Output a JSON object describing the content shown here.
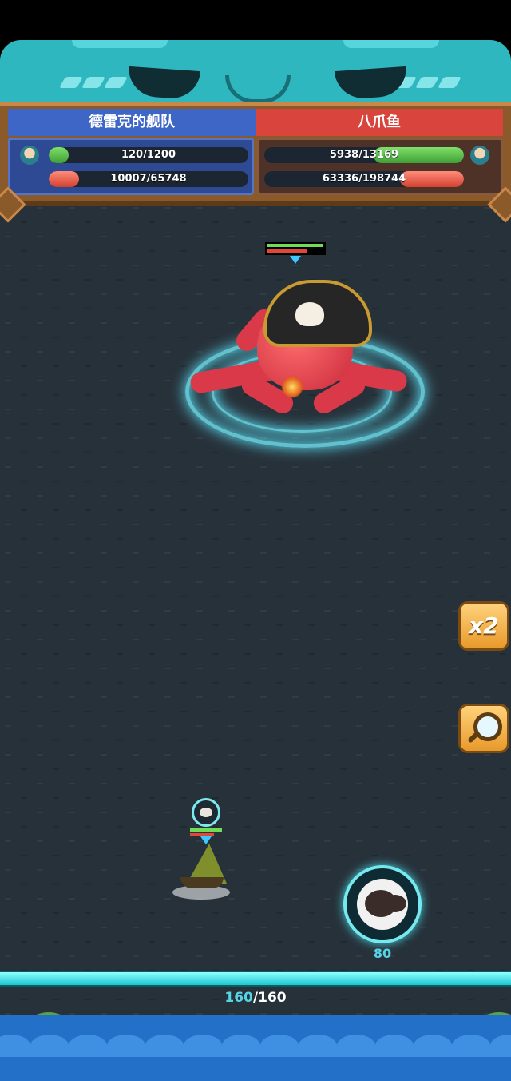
{
  "player_team": {
    "name": "德雷克的舰队",
    "crew_hp": "120/1200",
    "crew_fraction": 0.1,
    "ship_hp": "10007/65748",
    "ship_fraction": 0.152
  },
  "enemy_team": {
    "name": "八爪鱼",
    "crew_hp": "5938/13169",
    "crew_fraction": 0.451,
    "ship_hp": "63336/198744",
    "ship_fraction": 0.319
  },
  "controls": {
    "speed_label": "x2",
    "skill_cost": "80"
  },
  "energy": {
    "current": "160",
    "separator": "/",
    "max": "160",
    "fraction": 1.0
  },
  "icons": {
    "crew": "crew-icon",
    "ship": "ship-icon",
    "speed": "speed-x2-icon",
    "zoom": "magnifier-icon",
    "skill": "cannonball-icon"
  },
  "colors": {
    "player_blue": "#3e66c6",
    "enemy_red": "#d9453d",
    "hp_green": "#6fdc58",
    "hp_red": "#e4463a",
    "energy_cyan": "#56d4e6"
  }
}
